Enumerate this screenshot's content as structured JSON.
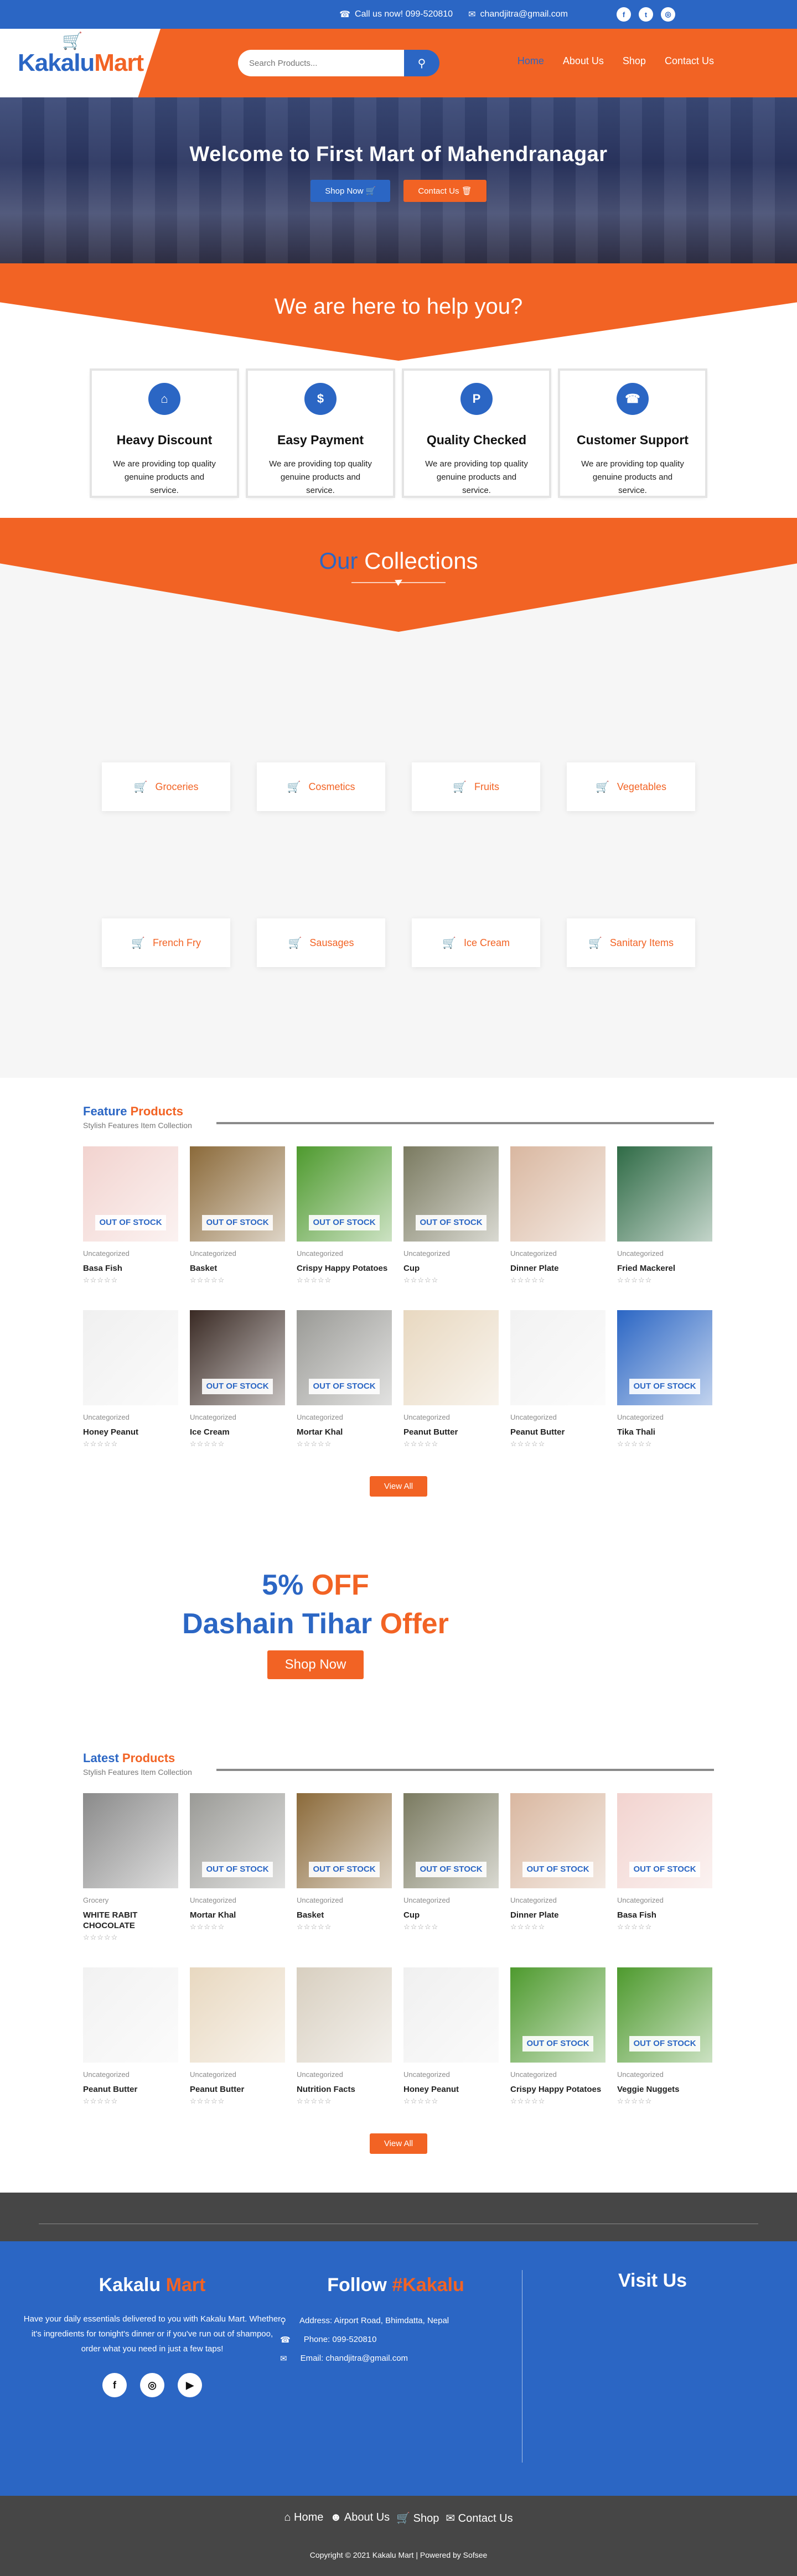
{
  "topbar": {
    "call": "Call us now! 099-520810",
    "email": "chandjitra@gmail.com"
  },
  "brand": {
    "kakalu": "Kakalu",
    "mart": "Mart"
  },
  "search": {
    "placeholder": "Search Products..."
  },
  "nav": [
    "Home",
    "About Us",
    "Shop",
    "Contact Us"
  ],
  "hero": {
    "title": "Welcome to First Mart of Mahendranagar",
    "shop_now": "Shop Now",
    "contact_us": "Contact Us"
  },
  "help": {
    "title": "We are here to help you?"
  },
  "features": [
    {
      "icon": "discount-icon",
      "title": "Heavy Discount",
      "text": "We are providing top quality genuine products and service."
    },
    {
      "icon": "payment-icon",
      "title": "Easy Payment",
      "text": "We are providing top quality genuine products and service."
    },
    {
      "icon": "quality-icon",
      "title": "Quality Checked",
      "text": "We are providing top quality genuine products and service."
    },
    {
      "icon": "support-icon",
      "title": "Customer Support",
      "text": "We are providing top quality genuine products and service."
    }
  ],
  "collections": {
    "our": "Our",
    "title": "Collections",
    "items": [
      "Groceries",
      "Cosmetics",
      "Fruits",
      "Vegetables",
      "French Fry",
      "Sausages",
      "Ice Cream",
      "Sanitary Items"
    ]
  },
  "feature_products": {
    "t1": "Feature",
    "t2": "Products",
    "sub": "Stylish Features Item Collection",
    "view_all": "View All",
    "items": [
      {
        "cat": "Uncategorized",
        "name": "Basa Fish",
        "oos": "OUT OF STOCK",
        "color": "#f2d3cf"
      },
      {
        "cat": "Uncategorized",
        "name": "Basket",
        "oos": "OUT OF STOCK",
        "color": "#8b6a3a"
      },
      {
        "cat": "Uncategorized",
        "name": "Crispy Happy Potatoes",
        "oos": "OUT OF STOCK",
        "color": "#4e9a2e"
      },
      {
        "cat": "Uncategorized",
        "name": "Cup",
        "oos": "OUT OF STOCK",
        "color": "#7a7a60"
      },
      {
        "cat": "Uncategorized",
        "name": "Dinner Plate",
        "oos": "",
        "color": "#d9b7a0"
      },
      {
        "cat": "Uncategorized",
        "name": "Fried Mackerel",
        "oos": "",
        "color": "#2f6b46"
      },
      {
        "cat": "Uncategorized",
        "name": "Honey Peanut",
        "oos": "",
        "color": "#f0f0f0"
      },
      {
        "cat": "Uncategorized",
        "name": "Ice Cream",
        "oos": "OUT OF STOCK",
        "color": "#3a2a24"
      },
      {
        "cat": "Uncategorized",
        "name": "Mortar Khal",
        "oos": "OUT OF STOCK",
        "color": "#9a9a96"
      },
      {
        "cat": "Uncategorized",
        "name": "Peanut Butter",
        "oos": "",
        "color": "#e8d8c0"
      },
      {
        "cat": "Uncategorized",
        "name": "Peanut Butter",
        "oos": "",
        "color": "#f2f2f2"
      },
      {
        "cat": "Uncategorized",
        "name": "Tika Thali",
        "oos": "OUT OF STOCK",
        "color": "#2b66c4"
      }
    ]
  },
  "offer": {
    "pct": "5%",
    "off": "OFF",
    "d1": "Dashain Tihar",
    "d2": "Offer",
    "shop": "Shop Now"
  },
  "latest_products": {
    "t1": "Latest",
    "t2": "Products",
    "sub": "Stylish Features Item Collection",
    "view_all": "View All",
    "items": [
      {
        "cat": "Grocery",
        "name": "WHITE RABIT CHOCOLATE",
        "oos": "",
        "color": "#8a8a8a"
      },
      {
        "cat": "Uncategorized",
        "name": "Mortar Khal",
        "oos": "OUT OF STOCK",
        "color": "#9a9a96"
      },
      {
        "cat": "Uncategorized",
        "name": "Basket",
        "oos": "OUT OF STOCK",
        "color": "#8b6a3a"
      },
      {
        "cat": "Uncategorized",
        "name": "Cup",
        "oos": "OUT OF STOCK",
        "color": "#7a7a60"
      },
      {
        "cat": "Uncategorized",
        "name": "Dinner Plate",
        "oos": "OUT OF STOCK",
        "color": "#d9b7a0"
      },
      {
        "cat": "Uncategorized",
        "name": "Basa Fish",
        "oos": "OUT OF STOCK",
        "color": "#f2d3cf"
      },
      {
        "cat": "Uncategorized",
        "name": "Peanut Butter",
        "oos": "",
        "color": "#f2f2f2"
      },
      {
        "cat": "Uncategorized",
        "name": "Peanut Butter",
        "oos": "",
        "color": "#e8d8c0"
      },
      {
        "cat": "Uncategorized",
        "name": "Nutrition Facts",
        "oos": "",
        "color": "#d8cfc0"
      },
      {
        "cat": "Uncategorized",
        "name": "Honey Peanut",
        "oos": "",
        "color": "#f0f0f0"
      },
      {
        "cat": "Uncategorized",
        "name": "Crispy Happy Potatoes",
        "oos": "OUT OF STOCK",
        "color": "#4e9a2e"
      },
      {
        "cat": "Uncategorized",
        "name": "Veggie Nuggets",
        "oos": "OUT OF STOCK",
        "color": "#4e9a2e"
      }
    ]
  },
  "footer": {
    "brand1": "Kakalu",
    "brand2": "Mart",
    "about": "Have your daily essentials delivered to you with Kakalu Mart. Whether it's ingredients for tonight's dinner or if you've run out of shampoo, order what you need in just a few taps!",
    "follow1": "Follow",
    "follow2": "#Kakalu",
    "address": "Address: Airport Road, Bhimdatta, Nepal",
    "phone": "Phone: 099-520810",
    "email": "Email: chandjitra@gmail.com",
    "visit": "Visit Us",
    "links": [
      "Home",
      "About Us",
      "Shop",
      "Contact Us"
    ],
    "copyright": "Copyright © 2021 Kakalu Mart | Powered by Sofsee"
  },
  "colors": {
    "primary": "#2b66c4",
    "accent": "#f26324"
  }
}
